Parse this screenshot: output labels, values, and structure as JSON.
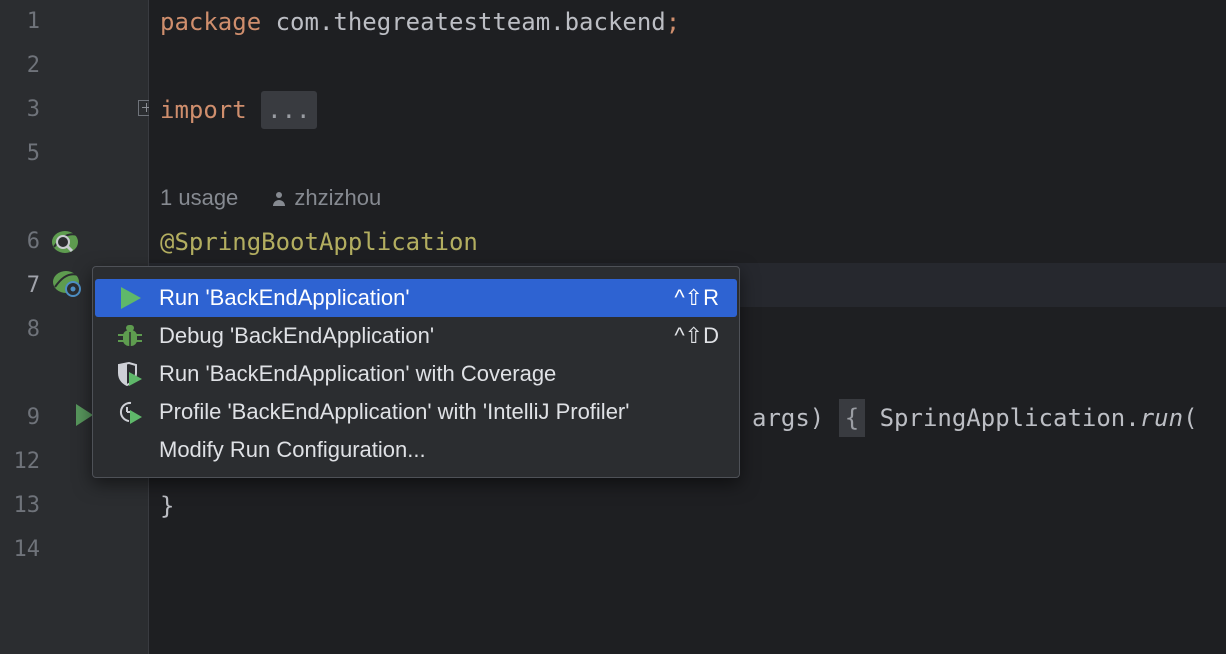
{
  "gutter": {
    "line_numbers": [
      "1",
      "2",
      "3",
      "5",
      "6",
      "7",
      "8",
      "9",
      "12",
      "13",
      "14"
    ]
  },
  "editor": {
    "line1": {
      "keyword": "package",
      "text": " com.thegreatestteam.backend",
      "semicolon": ";"
    },
    "line3": {
      "keyword": "import",
      "folded": "..."
    },
    "inlay": {
      "usages": "1 usage",
      "author": "zhzizhou"
    },
    "line6": {
      "annotation": "@SpringBootApplication"
    },
    "line9": {
      "args": "args)",
      "brace": "{",
      "call": "SpringApplication.",
      "method": "run",
      "paren": "("
    },
    "line13": {
      "text": "}"
    }
  },
  "popup": {
    "items": [
      {
        "icon": "run-icon",
        "label": "Run 'BackEndApplication'",
        "shortcut": "^⇧R"
      },
      {
        "icon": "debug-icon",
        "label": "Debug 'BackEndApplication'",
        "shortcut": "^⇧D"
      },
      {
        "icon": "coverage-icon",
        "label": "Run 'BackEndApplication' with Coverage",
        "shortcut": ""
      },
      {
        "icon": "profile-icon",
        "label": "Profile 'BackEndApplication' with 'IntelliJ Profiler'",
        "shortcut": ""
      },
      {
        "icon": "",
        "label": "Modify Run Configuration...",
        "shortcut": ""
      }
    ]
  },
  "colors": {
    "keyword": "#cf8e6d",
    "annotation": "#b3ae60",
    "selection": "#2e63d2",
    "run_green": "#57965c"
  }
}
